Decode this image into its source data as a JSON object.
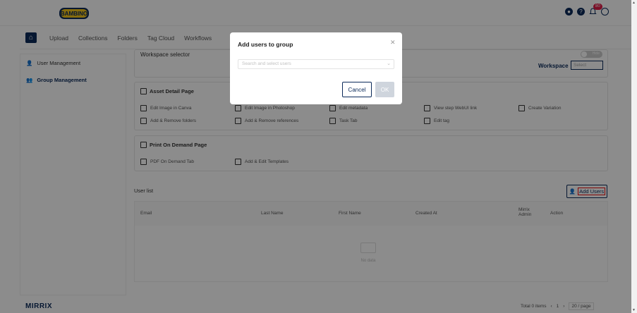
{
  "header": {
    "logo": "BAMBINO",
    "notification_count": "80"
  },
  "nav": {
    "items": [
      "Upload",
      "Collections",
      "Folders",
      "Tag Cloud",
      "Workflows"
    ]
  },
  "sidebar": {
    "items": [
      {
        "label": "User Management"
      },
      {
        "label": "Group Management"
      }
    ]
  },
  "workspace": {
    "label": "Workspace selector",
    "field_label": "Workspace",
    "select_value": "Select",
    "toggle_text": "Hide"
  },
  "asset_detail": {
    "title": "Asset Detail Page",
    "perms": [
      "Edit Image in Canva",
      "Edit Image in Photoshop",
      "Edit metadata",
      "View step WebUI link",
      "Create Variation",
      "Add & Remove folders",
      "Add & Remove references",
      "Task Tab",
      "Edit tag"
    ]
  },
  "print_on_demand": {
    "title": "Print On Demand Page",
    "perms": [
      "PDF On Demand Tab",
      "Add & Edit Templates"
    ]
  },
  "user_list": {
    "label": "User list",
    "add_button": "Add Users",
    "columns": [
      "Email",
      "Last Name",
      "First Name",
      "Created At",
      "Mirrix Admin",
      "Action"
    ],
    "empty_text": "No data"
  },
  "footer": {
    "logo": "MIRRIX",
    "total": "Total 0 items",
    "page": "1",
    "page_size": "20 / page"
  },
  "modal": {
    "title": "Add users to group",
    "placeholder": "Search and select users",
    "cancel": "Cancel",
    "ok": "OK"
  }
}
